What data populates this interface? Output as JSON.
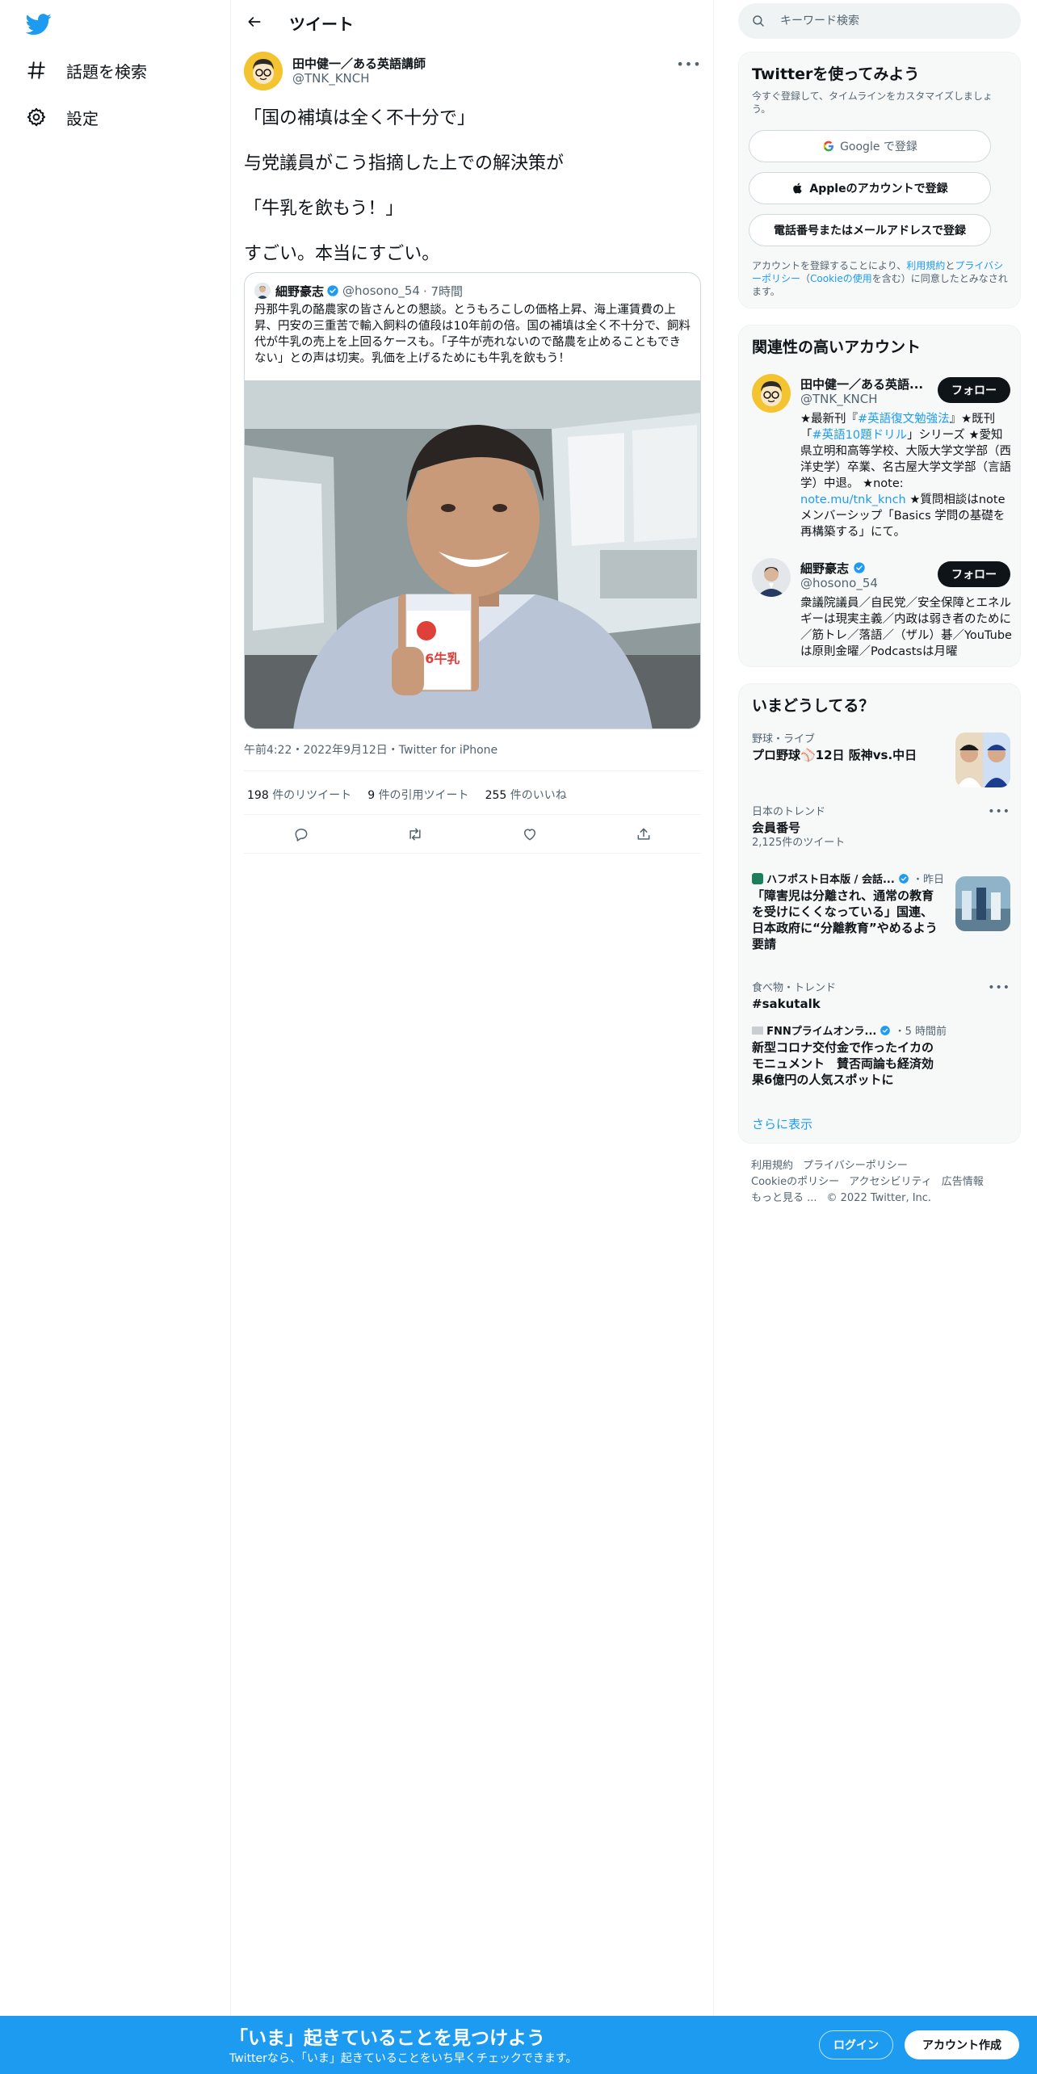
{
  "colors": {
    "brand": "#1d9bf0",
    "text": "#0f1419",
    "muted": "#536471"
  },
  "nav": {
    "logo_icon": "twitter-bird-icon",
    "items": [
      {
        "icon": "hashtag-icon",
        "label": "話題を検索"
      },
      {
        "icon": "gear-icon",
        "label": "設定"
      }
    ]
  },
  "header": {
    "back_icon": "arrow-left-icon",
    "title": "ツイート"
  },
  "tweet": {
    "author_name": "田中健一／ある英語講師",
    "author_handle": "@TNK_KNCH",
    "more_icon": "more-icon",
    "lines": [
      "「国の補填は全く不十分で」",
      "与党議員がこう指摘した上での解決策が",
      "「牛乳を飲もう！」",
      "すごい。本当にすごい。"
    ],
    "quote": {
      "name": "細野豪志",
      "handle": "@hosono_54",
      "time": "· 7時間",
      "text": "丹那牛乳の酪農家の皆さんとの懇談。とうもろこしの価格上昇、海上運賃費の上昇、円安の三重苦で輸入飼料の値段は10年前の倍。国の補填は全く不十分で、飼料代が牛乳の売上を上回るケースも。「子牛が売れないので酪農を止めることもできない」との声は切実。乳価を上げるためにも牛乳を飲もう！",
      "carton_text": "3.6牛乳"
    },
    "meta": "午前4:22・2022年9月12日・Twitter for iPhone",
    "stats": [
      {
        "count": "198",
        "label": "件のリツイート"
      },
      {
        "count": "9",
        "label": "件の引用ツイート"
      },
      {
        "count": "255",
        "label": "件のいいね"
      }
    ],
    "actions": [
      "reply-icon",
      "retweet-icon",
      "like-icon",
      "share-icon"
    ]
  },
  "search": {
    "placeholder": "キーワード検索"
  },
  "signup_panel": {
    "title": "Twitterを使ってみよう",
    "subtitle": "今すぐ登録して、タイムラインをカスタマイズしましょう。",
    "google": "Google で登録",
    "apple": "Appleのアカウントで登録",
    "phone": "電話番号またはメールアドレスで登録",
    "legal_1": "アカウントを登録することにより、",
    "legal_terms": "利用規約",
    "legal_2": "と",
    "legal_privacy": "プライバシーポリシー",
    "legal_3": "（",
    "legal_cookie": "Cookieの使用",
    "legal_4": "を含む）に同意したとみなされます。"
  },
  "related": {
    "title": "関連性の高いアカウント",
    "accounts": [
      {
        "name": "田中健一／ある英語...",
        "handle": "@TNK_KNCH",
        "follow": "フォロー",
        "bio_1": "★最新刊『",
        "bio_link1": "#英語復文勉強法",
        "bio_2": "』★既刊「",
        "bio_link2": "#英語10題ドリル",
        "bio_3": "」シリーズ ★愛知県立明和高等学校、大阪大学文学部（西洋史学）卒業、名古屋大学文学部（言語学）中退。 ★note: ",
        "bio_link3": "note.mu/tnk_knch",
        "bio_4": " ★質問相談はnoteメンバーシップ「Basics 学問の基礎を再構築する」にて。"
      },
      {
        "name": "細野豪志",
        "handle": "@hosono_54",
        "follow": "フォロー",
        "bio": "衆議院議員／自民党／安全保障とエネルギーは現実主義／内政は弱き者のために／筋トレ／落語／（ザル）碁／YouTubeは原則金曜／Podcastsは月曜"
      }
    ]
  },
  "trends": {
    "title": "いまどうしてる？",
    "items": [
      {
        "category": "野球・ライブ",
        "title": "プロ野球⚾12日 阪神vs.中日"
      },
      {
        "category": "日本のトレンド",
        "title": "会員番号",
        "count": "2,125件のツイート"
      },
      {
        "source": "ハフポスト日本版 / 会話...",
        "time": "・昨日",
        "title": "「障害児は分離され、通常の教育を受けにくくなっている」国連、日本政府に“分離教育”やめるよう要請"
      },
      {
        "category": "食べ物・トレンド",
        "title": "#sakutalk"
      },
      {
        "source": "FNNプライムオンラ...",
        "time": "・5 時間前",
        "title": "新型コロナ交付金で作ったイカのモニュメント　賛否両論も経済効果6億円の人気スポットに"
      }
    ],
    "show_more": "さらに表示"
  },
  "footer": {
    "links": [
      "利用規約",
      "プライバシーポリシー",
      "Cookieのポリシー",
      "アクセシビリティ",
      "広告情報",
      "もっと見る ..."
    ],
    "copyright": "© 2022 Twitter, Inc."
  },
  "bottom_bar": {
    "title": "「いま」起きていることを見つけよう",
    "subtitle": "Twitterなら、「いま」起きていることをいち早くチェックできます。",
    "login": "ログイン",
    "signup": "アカウント作成"
  }
}
